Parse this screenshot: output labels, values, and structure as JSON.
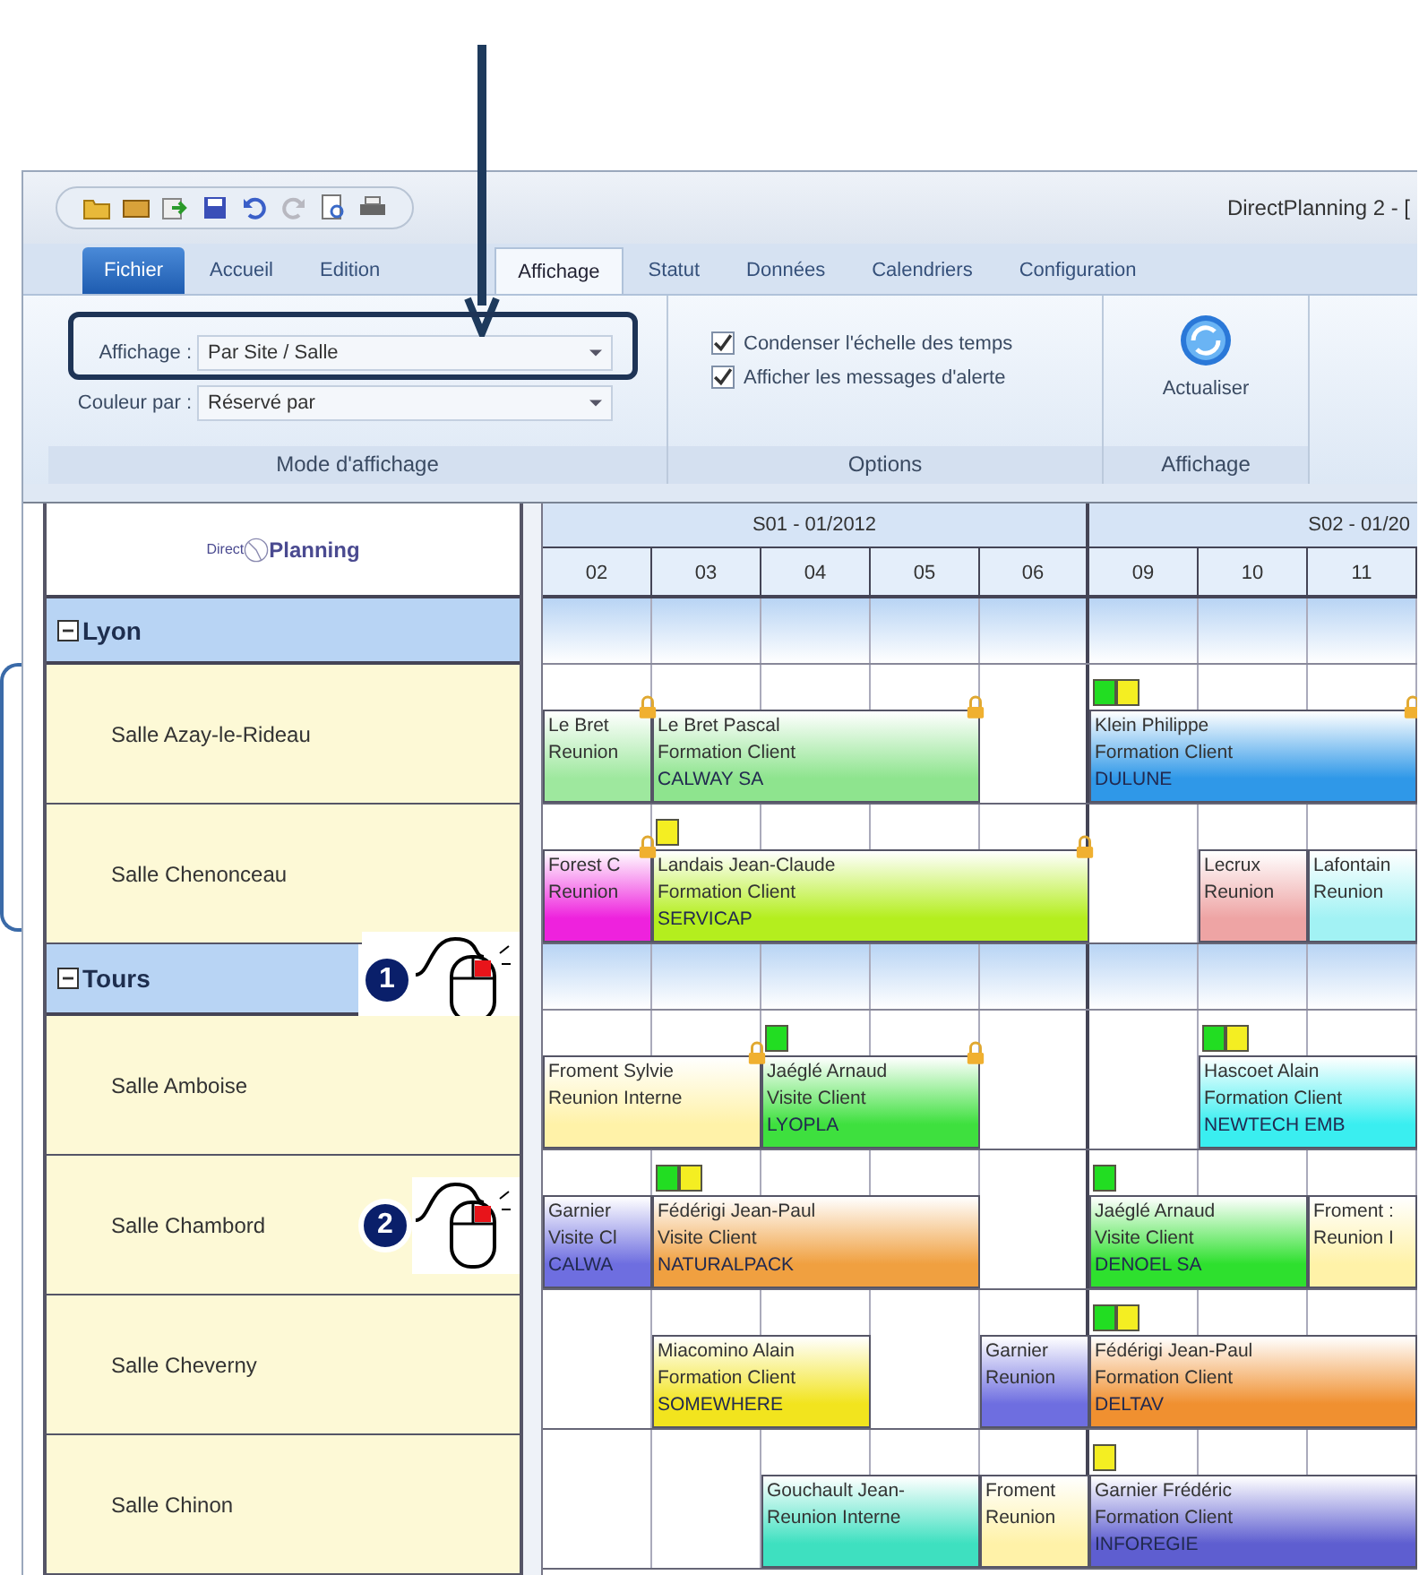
{
  "window": {
    "title": "DirectPlanning 2 - ["
  },
  "tabs": [
    {
      "label": "Fichier",
      "kind": "file",
      "selected": false
    },
    {
      "label": "Accueil",
      "kind": "tab",
      "selected": false
    },
    {
      "label": "Edition",
      "kind": "tab",
      "selected": false
    },
    {
      "label": "Affichage",
      "kind": "tab",
      "selected": true
    },
    {
      "label": "Statut",
      "kind": "tab",
      "selected": false
    },
    {
      "label": "Données",
      "kind": "tab",
      "selected": false
    },
    {
      "label": "Calendriers",
      "kind": "tab",
      "selected": false
    },
    {
      "label": "Configuration",
      "kind": "tab",
      "selected": false
    }
  ],
  "ribbon": {
    "groups": [
      {
        "kind": "fields",
        "label": "Mode d'affichage",
        "fields": [
          {
            "label": "Affichage :",
            "value": "Par Site / Salle"
          },
          {
            "label": "Couleur par :",
            "value": "Réservé par"
          }
        ]
      },
      {
        "kind": "checks",
        "label": "Options",
        "checks": [
          {
            "label": "Condenser l'échelle des temps",
            "checked": true
          },
          {
            "label": "Afficher les messages d'alerte",
            "checked": true
          }
        ]
      },
      {
        "kind": "buttons",
        "label": "Affichage",
        "buttons": [
          {
            "label": "Actualiser"
          }
        ]
      }
    ]
  },
  "planning": {
    "logo": {
      "left": "Direct",
      "right": "Planning"
    },
    "weeks": [
      {
        "label": "S01 - 01/2012",
        "days": [
          "02",
          "03",
          "04",
          "05",
          "06"
        ]
      },
      {
        "label": "S02 - 01/20",
        "days": [
          "09",
          "10",
          "11"
        ]
      }
    ],
    "rows": [
      {
        "kind": "group",
        "label": "Lyon",
        "expanded": true
      },
      {
        "kind": "room",
        "label": "Salle Azay-le-Rideau",
        "cells": [
          {
            "kind": "event",
            "name": "Le Bret",
            "type": "Reunion",
            "locked": true,
            "color": "#9ee89e"
          },
          {
            "kind": "event",
            "name": "Le Bret Pascal",
            "type": "Formation Client",
            "client": "CALWAY SA",
            "locked": true,
            "color": "#8ee48e"
          },
          {
            "kind": "cont"
          },
          {
            "kind": "cont"
          },
          {
            "kind": "free"
          },
          {
            "kind": "event",
            "name": "Klein Philippe",
            "type": "Formation Client",
            "client": "DULUNE",
            "locked": true,
            "flags": [
              {
                "color": "#22dd22"
              },
              {
                "color": "#f4ee22"
              }
            ],
            "color": "#2f98e8"
          },
          {
            "kind": "cont"
          },
          {
            "kind": "cont"
          }
        ]
      },
      {
        "kind": "room",
        "label": "Salle Chenonceau",
        "cells": [
          {
            "kind": "event",
            "name": "Forest C",
            "type": "Reunion",
            "locked": true,
            "color": "#ee22dd"
          },
          {
            "kind": "event",
            "name": "Landais Jean-Claude",
            "type": "Formation Client",
            "client": "SERVICAP",
            "locked": true,
            "flags": [
              {
                "color": "#f4ee22"
              }
            ],
            "color": "#b4ee1e"
          },
          {
            "kind": "cont"
          },
          {
            "kind": "cont"
          },
          {
            "kind": "cont"
          },
          {
            "kind": "free"
          },
          {
            "kind": "event",
            "name": "Lecrux",
            "type": "Reunion",
            "locked": false,
            "color": "#eea4a4"
          },
          {
            "kind": "event",
            "name": "Lafontain",
            "type": "Reunion",
            "locked": false,
            "color": "#a2f2f4"
          }
        ]
      },
      {
        "kind": "group",
        "label": "Tours",
        "expanded": true,
        "callout": "1"
      },
      {
        "kind": "room",
        "label": "Salle Amboise",
        "cells": [
          {
            "kind": "event",
            "name": "Froment Sylvie",
            "type": "Reunion Interne",
            "locked": true,
            "color": "#fff2a8"
          },
          {
            "kind": "cont"
          },
          {
            "kind": "event",
            "name": "Jaéglé Arnaud",
            "type": "Visite Client",
            "client": "LYOPLA",
            "locked": true,
            "flags": [
              {
                "color": "#22dd22"
              }
            ],
            "color": "#3ee03e"
          },
          {
            "kind": "cont"
          },
          {
            "kind": "free"
          },
          {
            "kind": "free"
          },
          {
            "kind": "event",
            "name": "Hascoet Alain",
            "type": "Formation Client",
            "client": "NEWTECH EMB",
            "locked": false,
            "flags": [
              {
                "color": "#22dd22"
              },
              {
                "color": "#f4ee22"
              }
            ],
            "color": "#3aeef0"
          },
          {
            "kind": "cont"
          }
        ]
      },
      {
        "kind": "room",
        "label": "Salle Chambord",
        "callout": "2",
        "cells": [
          {
            "kind": "event",
            "name": "Garnier",
            "type": "Visite Cl",
            "client": "CALWA",
            "locked": false,
            "color": "#6e6ee0"
          },
          {
            "kind": "event",
            "name": "Fédérigi Jean-Paul",
            "type": "Visite Client",
            "client": "NATURALPACK",
            "locked": false,
            "flags": [
              {
                "color": "#22dd22"
              },
              {
                "color": "#f4ee22"
              }
            ],
            "color": "#f0a040"
          },
          {
            "kind": "cont"
          },
          {
            "kind": "cont"
          },
          {
            "kind": "free"
          },
          {
            "kind": "event",
            "name": "Jaéglé Arnaud",
            "type": "Visite Client",
            "client": "DENOEL SA",
            "locked": false,
            "flags": [
              {
                "color": "#22dd22"
              }
            ],
            "color": "#2ee02e"
          },
          {
            "kind": "cont"
          },
          {
            "kind": "event",
            "name": "Froment :",
            "type": "Reunion I",
            "locked": false,
            "color": "#fff2a8"
          }
        ]
      },
      {
        "kind": "room",
        "label": "Salle Cheverny",
        "cells": [
          {
            "kind": "free"
          },
          {
            "kind": "event",
            "name": "Miacomino Alain",
            "type": "Formation Client",
            "client": "SOMEWHERE",
            "locked": false,
            "color": "#f2e41e"
          },
          {
            "kind": "cont"
          },
          {
            "kind": "free"
          },
          {
            "kind": "event",
            "name": "Garnier",
            "type": "Reunion",
            "locked": false,
            "color": "#6e6ee0"
          },
          {
            "kind": "event",
            "name": "Fédérigi Jean-Paul",
            "type": "Formation Client",
            "client": "DELTAV",
            "locked": false,
            "flags": [
              {
                "color": "#22dd22"
              },
              {
                "color": "#f4ee22"
              }
            ],
            "color": "#f09030"
          },
          {
            "kind": "cont"
          },
          {
            "kind": "cont"
          }
        ]
      },
      {
        "kind": "room",
        "label": "Salle Chinon",
        "cells": [
          {
            "kind": "free"
          },
          {
            "kind": "free"
          },
          {
            "kind": "event",
            "name": "Gouchault Jean-",
            "type": "Reunion Interne",
            "locked": false,
            "color": "#3ee0c0"
          },
          {
            "kind": "cont"
          },
          {
            "kind": "event",
            "name": "Froment",
            "type": "Reunion",
            "locked": false,
            "color": "#fff2a8"
          },
          {
            "kind": "event",
            "name": "Garnier Frédéric",
            "type": "Formation Client",
            "client": "INFOREGIE",
            "locked": false,
            "flags": [
              {
                "color": "#f4ee22"
              }
            ],
            "color": "#5e5ed0"
          },
          {
            "kind": "cont"
          },
          {
            "kind": "cont"
          }
        ]
      }
    ]
  }
}
